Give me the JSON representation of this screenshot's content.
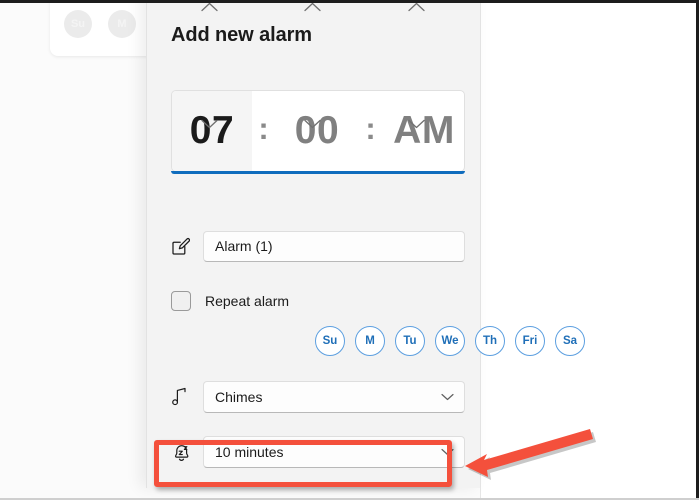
{
  "panel": {
    "title": "Add new alarm"
  },
  "time_picker": {
    "hour": "07",
    "minute": "00",
    "meridiem": "AM",
    "separator": ":",
    "up_icon": "chevron-up-icon",
    "down_icon": "chevron-down-icon",
    "accent_color": "#0f6cbd"
  },
  "alarm_name": {
    "icon": "edit-pencil-icon",
    "value": "Alarm (1)"
  },
  "repeat": {
    "label": "Repeat alarm",
    "checked": false,
    "days": [
      {
        "label": "Su",
        "selected": false
      },
      {
        "label": "M",
        "selected": false
      },
      {
        "label": "Tu",
        "selected": false
      },
      {
        "label": "We",
        "selected": false
      },
      {
        "label": "Th",
        "selected": false
      },
      {
        "label": "Fri",
        "selected": false
      },
      {
        "label": "Sa",
        "selected": false
      }
    ],
    "day_color": "#1f6fb8"
  },
  "sound": {
    "icon": "music-note-icon",
    "value": "Chimes",
    "chevron": "chevron-down-icon"
  },
  "snooze": {
    "icon": "snooze-bell-icon",
    "value": "10 minutes",
    "chevron": "chevron-down-icon"
  },
  "annotation": {
    "highlight_color": "#f4503c",
    "arrow_icon": "left-arrow-annotation"
  },
  "background_card": {
    "days": [
      "Su",
      "M",
      ""
    ]
  }
}
